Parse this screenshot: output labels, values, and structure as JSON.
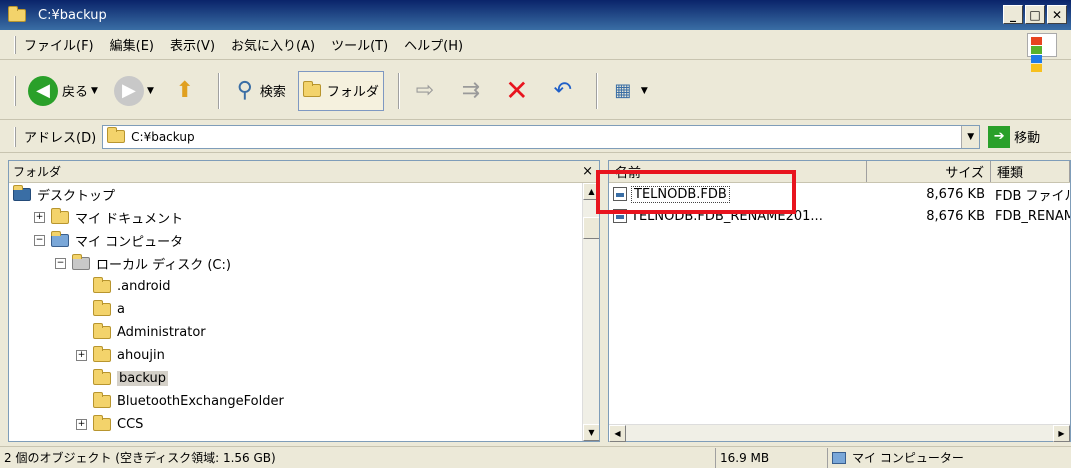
{
  "window": {
    "title": "C:¥backup"
  },
  "menu": [
    "ファイル(F)",
    "編集(E)",
    "表示(V)",
    "お気に入り(A)",
    "ツール(T)",
    "ヘルプ(H)"
  ],
  "toolbar": {
    "back_label": "戻る",
    "search_label": "検索",
    "folders_label": "フォルダ"
  },
  "address": {
    "label": "アドレス(D)",
    "value": "C:¥backup",
    "go_label": "移動"
  },
  "folder_pane": {
    "title": "フォルダ",
    "close": "×",
    "tree": [
      {
        "label": "デスクトップ",
        "icon": "desktop-icon",
        "indent": 0,
        "expander": ""
      },
      {
        "label": "マイ ドキュメント",
        "icon": "my-documents-icon",
        "indent": 1,
        "expander": "+"
      },
      {
        "label": "マイ コンピュータ",
        "icon": "my-computer-icon",
        "indent": 1,
        "expander": "−"
      },
      {
        "label": "ローカル ディスク (C:)",
        "icon": "drive-icon",
        "indent": 2,
        "expander": "−"
      },
      {
        "label": ".android",
        "icon": "folder-icon",
        "indent": 3,
        "expander": ""
      },
      {
        "label": "a",
        "icon": "folder-icon",
        "indent": 3,
        "expander": ""
      },
      {
        "label": "Administrator",
        "icon": "folder-icon",
        "indent": 3,
        "expander": ""
      },
      {
        "label": "ahoujin",
        "icon": "folder-icon",
        "indent": 3,
        "expander": "+"
      },
      {
        "label": "backup",
        "icon": "folder-open-icon",
        "indent": 3,
        "expander": "",
        "selected": true
      },
      {
        "label": "BluetoothExchangeFolder",
        "icon": "folder-icon",
        "indent": 3,
        "expander": ""
      },
      {
        "label": "CCS",
        "icon": "folder-icon",
        "indent": 3,
        "expander": "+"
      }
    ]
  },
  "file_list": {
    "columns": {
      "name": "名前",
      "size": "サイズ",
      "type": "種類"
    },
    "rows": [
      {
        "name": "TELNODB.FDB",
        "size": "8,676 KB",
        "type": "FDB ファイル"
      },
      {
        "name": "TELNODB.FDB_RENAME201...",
        "size": "8,676 KB",
        "type": "FDB_RENAME"
      }
    ]
  },
  "status": {
    "objects": "2 個のオブジェクト (空きディスク領域: 1.56 GB)",
    "size": "16.9 MB",
    "location": "マイ コンピューター"
  }
}
